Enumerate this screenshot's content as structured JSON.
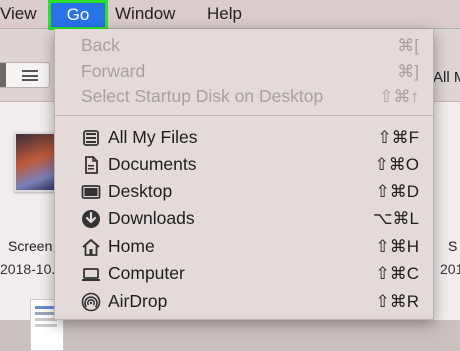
{
  "menubar": {
    "view": "View",
    "go": "Go",
    "window": "Window",
    "help": "Help"
  },
  "finder": {
    "right_tab": "All M",
    "file_name": "Screen",
    "file_date": "2018-10.",
    "right_file_name": "S",
    "right_file_date": "201"
  },
  "go_menu": {
    "disabled_items": [
      {
        "label": "Back",
        "shortcut": "⌘["
      },
      {
        "label": "Forward",
        "shortcut": "⌘]"
      },
      {
        "label": "Select Startup Disk on Desktop",
        "shortcut": "⇧⌘↑"
      }
    ],
    "items": [
      {
        "label": "All My Files",
        "shortcut": "⇧⌘F",
        "icon": "all-my-files-icon"
      },
      {
        "label": "Documents",
        "shortcut": "⇧⌘O",
        "icon": "documents-icon"
      },
      {
        "label": "Desktop",
        "shortcut": "⇧⌘D",
        "icon": "desktop-icon"
      },
      {
        "label": "Downloads",
        "shortcut": "⌥⌘L",
        "icon": "downloads-icon"
      },
      {
        "label": "Home",
        "shortcut": "⇧⌘H",
        "icon": "home-icon"
      },
      {
        "label": "Computer",
        "shortcut": "⇧⌘C",
        "icon": "computer-icon"
      },
      {
        "label": "AirDrop",
        "shortcut": "⇧⌘R",
        "icon": "airdrop-icon"
      }
    ]
  }
}
